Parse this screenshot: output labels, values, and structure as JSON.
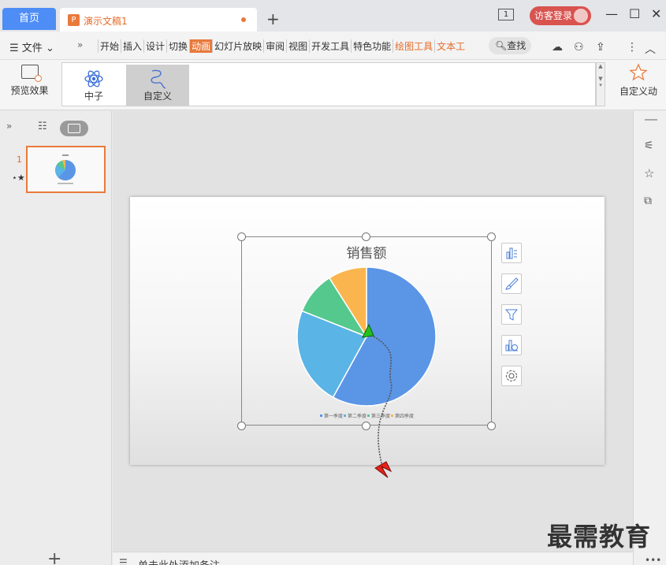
{
  "titlebar": {
    "home_tab": "首页",
    "doc_tab_icon": "P",
    "doc_tab_title": "演示文稿1",
    "new_tab": "+",
    "page_indicator": "1",
    "login": "访客登录",
    "minimize": "—",
    "maximize": "☐",
    "close": "✕"
  },
  "menu": {
    "file": "文件",
    "tabs": [
      "开始",
      "插入",
      "设计",
      "切换",
      "动画",
      "幻灯片放映",
      "审阅",
      "视图",
      "开发工具",
      "特色功能",
      "绘图工具",
      "文本工"
    ],
    "active_tab": "动画",
    "search": "查找"
  },
  "ribbon": {
    "preview": "预览效果",
    "effects": [
      "中子",
      "自定义"
    ],
    "custom_animation": "自定义动"
  },
  "slides_panel": {
    "slide_number": "1",
    "add": "+"
  },
  "chart_data": {
    "type": "pie",
    "title": "销售额",
    "categories": [
      "第一季度",
      "第二季度",
      "第三季度",
      "第四季度"
    ],
    "values": [
      58,
      23,
      10,
      9
    ],
    "colors": [
      "#5b95e6",
      "#5ab4e6",
      "#55c88e",
      "#fbb54f"
    ]
  },
  "notes": {
    "placeholder": "单击此处添加备注"
  },
  "watermark": "最需教育"
}
